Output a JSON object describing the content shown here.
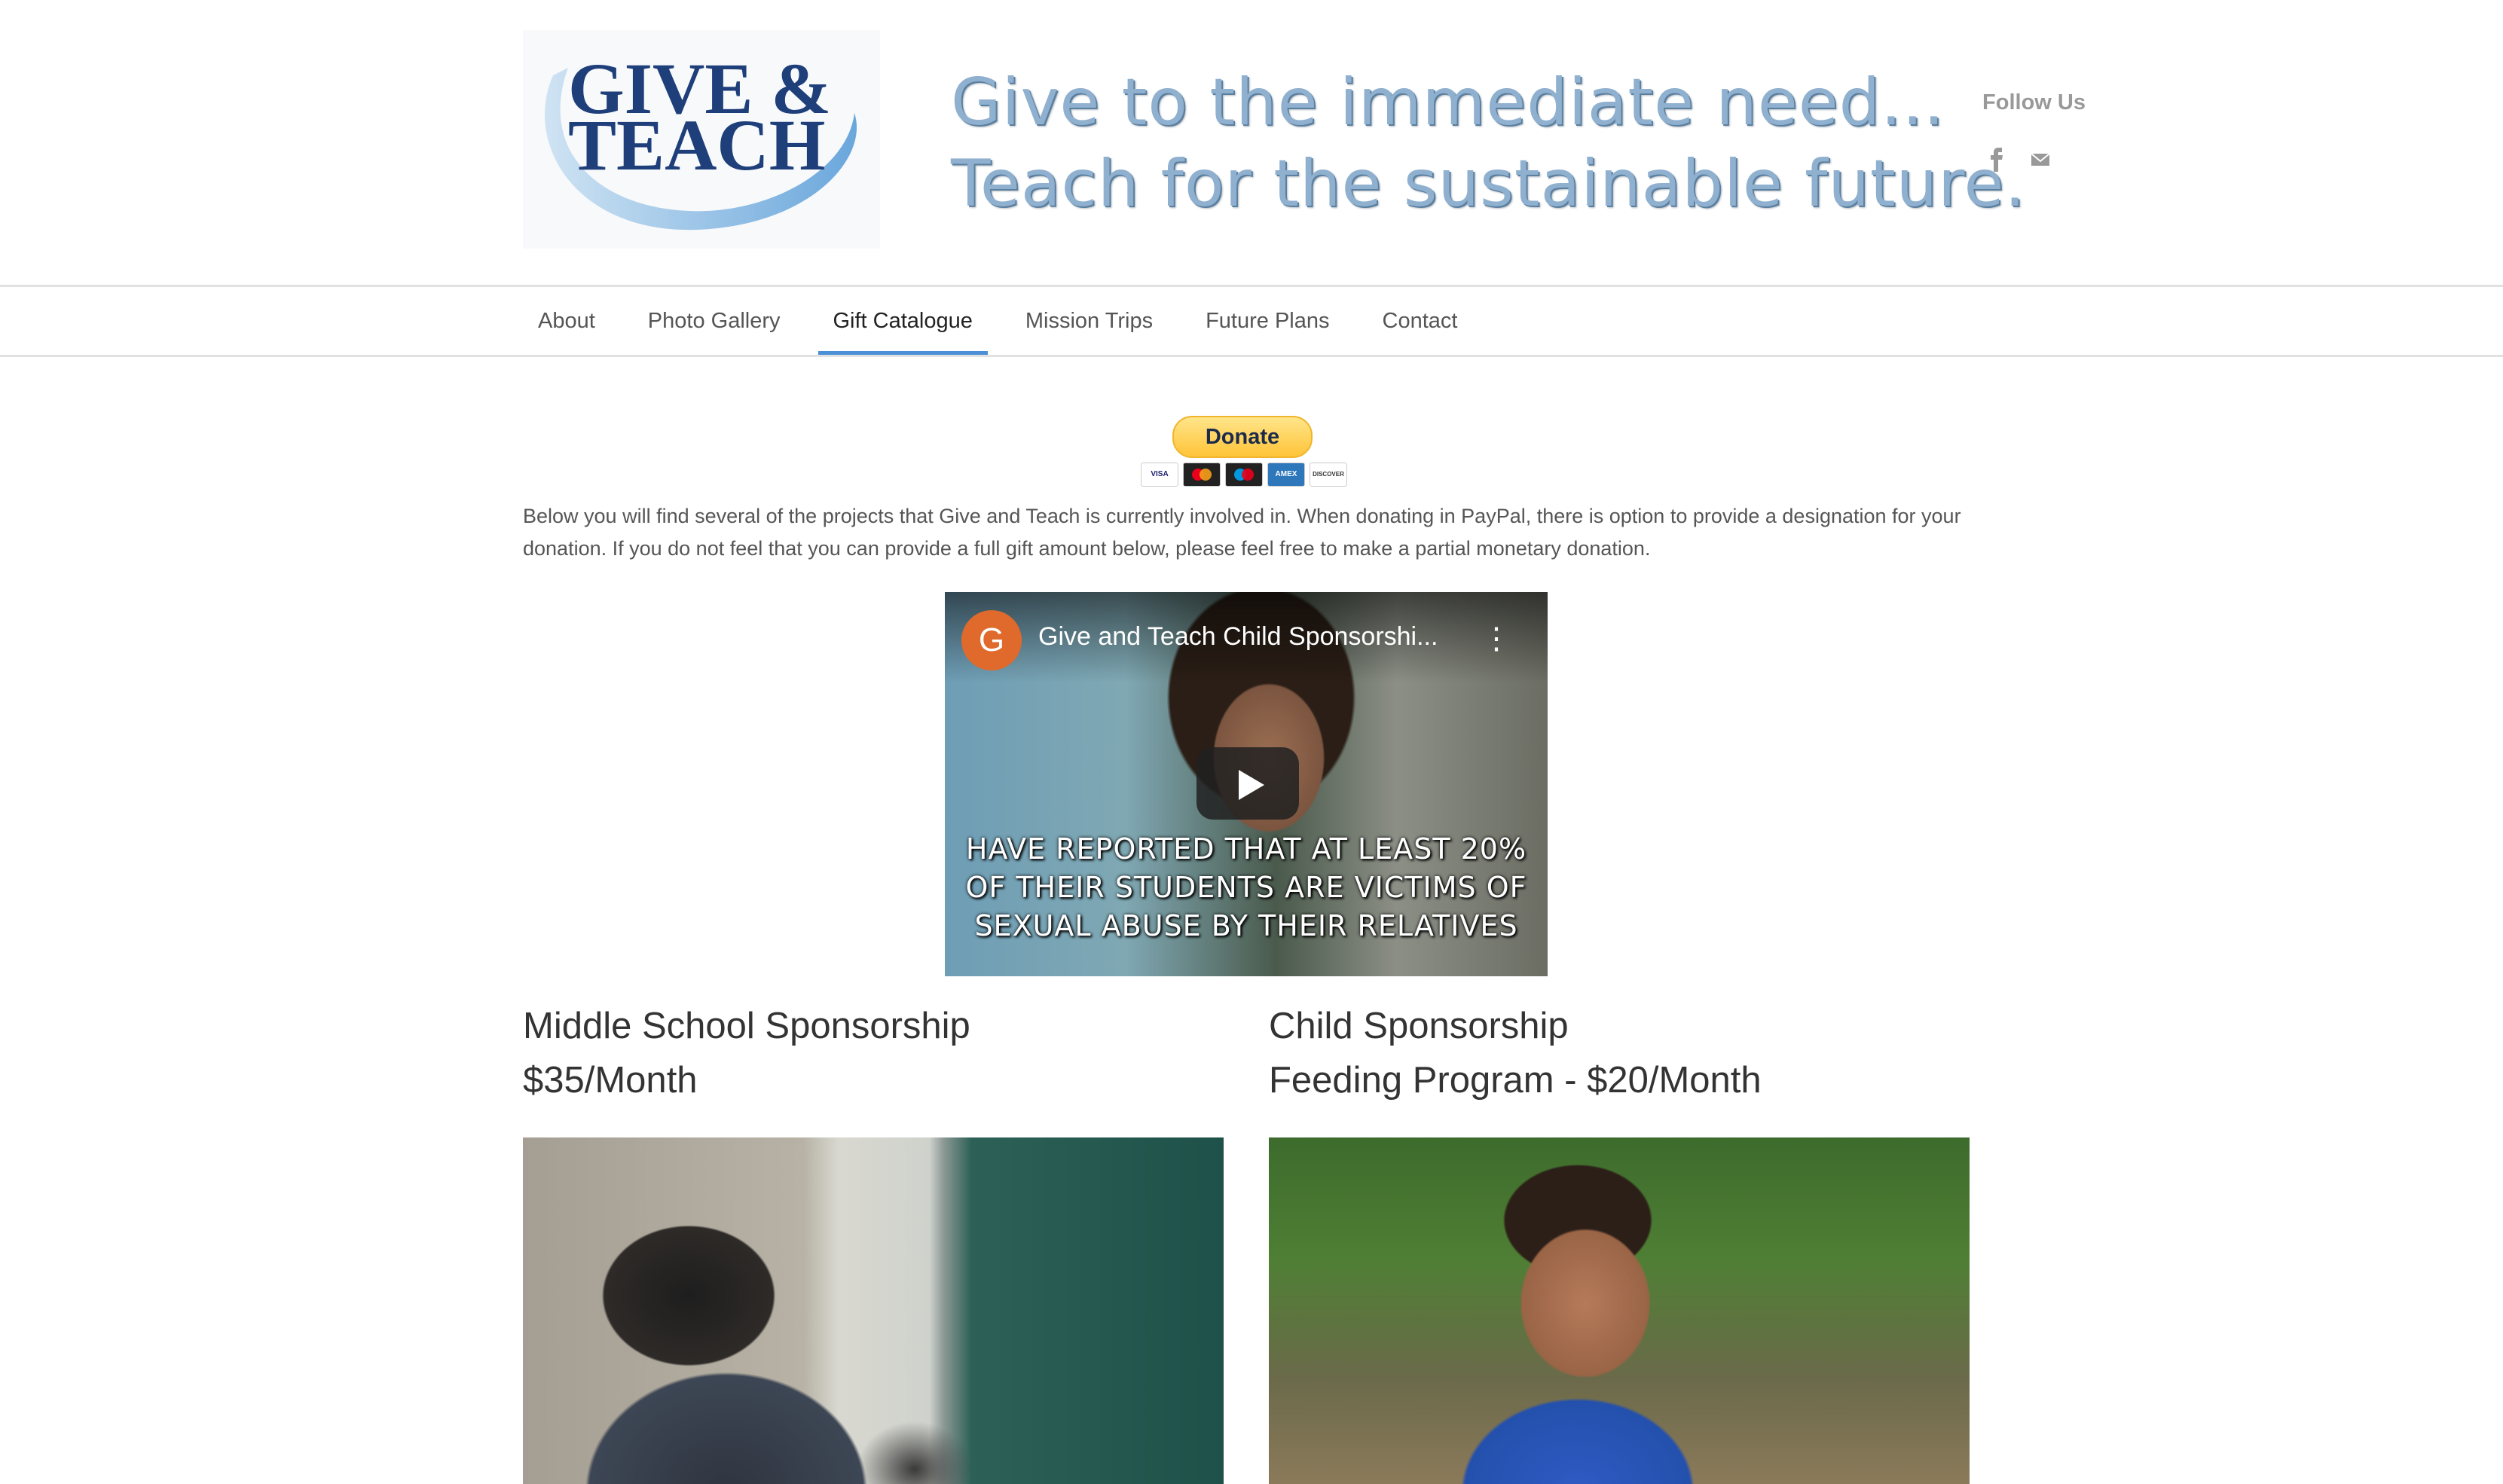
{
  "header": {
    "logo_line1": "GIVE &",
    "logo_line2": "TEACH",
    "tagline_line1": "Give to the immediate need...",
    "tagline_line2": "Teach for the sustainable future.",
    "follow_label": "Follow Us",
    "social_icons": [
      "facebook-icon",
      "email-icon"
    ]
  },
  "nav": {
    "items": [
      {
        "label": "About"
      },
      {
        "label": "Photo Gallery"
      },
      {
        "label": "Gift Catalogue",
        "active": true
      },
      {
        "label": "Mission Trips"
      },
      {
        "label": "Future Plans"
      },
      {
        "label": "Contact"
      }
    ]
  },
  "donate": {
    "button_label": "Donate",
    "cards": [
      "VISA",
      "",
      "",
      "AMEX",
      "DISCOVER"
    ]
  },
  "intro": {
    "text": "Below you will find several of the projects that Give and Teach is currently involved in.  When donating in PayPal, there is option to provide a designation for your donation.  If you do not feel that you can provide a full gift amount below, please feel free to make a partial monetary donation."
  },
  "video": {
    "channel_initial": "G",
    "title": "Give and Teach Child Sponsorshi...",
    "caption_line1": "HAVE REPORTED THAT AT LEAST 20%",
    "caption_line2": "OF THEIR STUDENTS ARE VICTIMS OF",
    "caption_line3": "SEXUAL ABUSE BY THEIR RELATIVES"
  },
  "projects": [
    {
      "title": "Middle School Sponsorship",
      "subtitle": "$35/Month"
    },
    {
      "title": "Child Sponsorship",
      "subtitle": "Feeding Program - $20/Month"
    }
  ],
  "colors": {
    "accent": "#4b8fd6",
    "logo_blue": "#1f3f7a",
    "paypal_yellow": "#ffc439"
  }
}
